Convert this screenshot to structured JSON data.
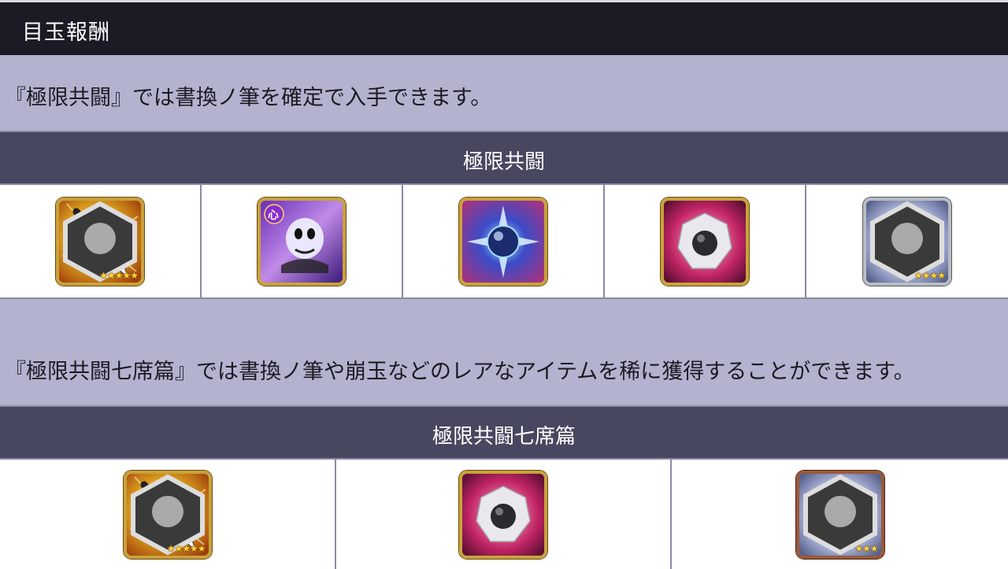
{
  "header": {
    "title": "目玉報酬"
  },
  "section1": {
    "description": "『極限共闘』では書換ノ筆を確定で入手できます。",
    "title": "極限共闘",
    "items": [
      {
        "icon": "brush-icon",
        "frame": "gold",
        "stars": "★★★★★",
        "badge": true
      },
      {
        "icon": "hollow-mask-card-icon",
        "frame": "gold",
        "badge_label": "心"
      },
      {
        "icon": "blue-orb-icon",
        "frame": "gold"
      },
      {
        "icon": "crystal-gem-icon",
        "frame": "gold"
      },
      {
        "icon": "dark-heart-icon",
        "frame": "silver",
        "stars": "★★★★",
        "badge": true
      }
    ]
  },
  "section2": {
    "description": "『極限共闘七席篇』では書換ノ筆や崩玉などのレアなアイテムを稀に獲得することができます。",
    "title": "極限共闘七席篇",
    "items": [
      {
        "icon": "brush-icon",
        "frame": "gold",
        "stars": "★★★★★",
        "badge": true
      },
      {
        "icon": "crystal-gem-icon",
        "frame": "gold"
      },
      {
        "icon": "dark-heart-icon",
        "frame": "bronze",
        "stars": "★★★",
        "badge": true
      }
    ]
  }
}
